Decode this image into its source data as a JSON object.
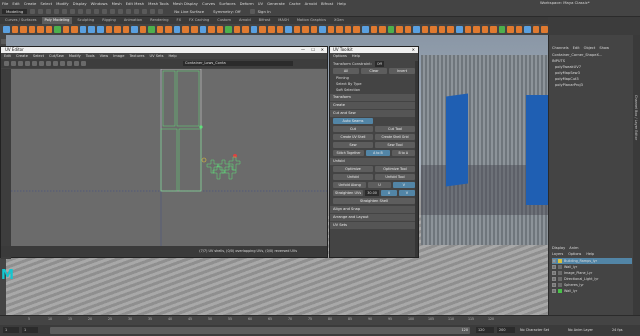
{
  "menubar": {
    "items": [
      "File",
      "Edit",
      "Create",
      "Select",
      "Modify",
      "Display",
      "Windows",
      "Mesh",
      "Edit Mesh",
      "Mesh Tools",
      "Mesh Display",
      "Curves",
      "Surfaces",
      "Deform",
      "UV",
      "Generate",
      "Cache",
      "Arnold",
      "Bifrost",
      "Help"
    ],
    "workspace_label": "Workspace:",
    "workspace_value": "Maya Classic*"
  },
  "statusline": {
    "mode": "Modeling",
    "live_surface": "No Live Surface",
    "symmetry": "Symmetry: Off",
    "signin": "Sign In"
  },
  "shelf": {
    "tabs": [
      "Curves / Surfaces",
      "Poly Modeling",
      "Sculpting",
      "Rigging",
      "Animation",
      "Rendering",
      "FX",
      "FX Caching",
      "Custom",
      "Arnold",
      "Bifrost",
      "MASH",
      "Motion Graphics",
      "XGen"
    ],
    "active_tab": "Poly Modeling",
    "icon_colors": [
      "#5aa0e0",
      "#e07a30",
      "#e07a30",
      "#e07a30",
      "#e07a30",
      "#e07a30",
      "#4db04d",
      "#e07a30",
      "#e07a30",
      "#5aa0e0",
      "#5aa0e0",
      "#5aa0e0",
      "#e07a30",
      "#e07a30",
      "#e07a30",
      "#5aa0e0",
      "#e07a30",
      "#4db04d",
      "#e07a30",
      "#e07a30",
      "#5aa0e0",
      "#e07a30",
      "#e07a30",
      "#5aa0e0",
      "#e07a30",
      "#e07a30",
      "#4db04d",
      "#e07a30",
      "#e07a30",
      "#5aa0e0",
      "#e07a30",
      "#e07a30",
      "#e07a30",
      "#5aa0e0",
      "#e07a30",
      "#e07a30",
      "#e07a30",
      "#5aa0e0",
      "#e07a30",
      "#e07a30",
      "#e07a30",
      "#e07a30",
      "#5aa0e0",
      "#e07a30",
      "#e07a30",
      "#4db04d",
      "#e07a30",
      "#e07a30",
      "#5aa0e0",
      "#e07a30",
      "#e07a30",
      "#e07a30",
      "#e07a30",
      "#5aa0e0",
      "#e07a30",
      "#e07a30",
      "#e07a30",
      "#e07a30",
      "#4db04d",
      "#e07a30",
      "#e07a30",
      "#5aa0e0",
      "#e07a30",
      "#e07a30"
    ]
  },
  "uv_editor": {
    "title": "UV Editor",
    "menu": [
      "Edit",
      "Create",
      "Select",
      "Cut/Sew",
      "Modify",
      "Tools",
      "View",
      "Image",
      "Textures",
      "UV Sets",
      "Help"
    ],
    "texture_field": "Container_Lows_Conta",
    "status": "(7/7) UV shells, (0/0) overlapping UVs, (0/0) reversed UVs"
  },
  "uv_toolkit": {
    "title": "UV Toolkit",
    "menu": [
      "Options",
      "Help"
    ],
    "transform_constraint_label": "Transform Constraint:",
    "transform_constraint_value": "Off",
    "row_buttons": [
      "All",
      "Clear",
      "Invert"
    ],
    "sections": {
      "pinning": "Pinning",
      "select_by_type": "Select By Type",
      "soft_selection": "Soft Selection",
      "transform": "Transform",
      "create": "Create",
      "cut_and_sew": "Cut and Sew",
      "unfold": "Unfold",
      "align_snap": "Align and Snap",
      "arrange_layout": "Arrange and Layout",
      "uv_sets": "UV Sets"
    },
    "cut_sew": {
      "auto_seams": "Auto Seams",
      "cut": "Cut",
      "cut_tool": "Cut Tool",
      "create_uv_shell": "Create UV Shell",
      "create_shell_grid": "Create Shell Grid",
      "sew": "Sew",
      "sew_tool": "Sew Tool",
      "stitch_together": "Stitch Together",
      "stitch_a_b": "A to B",
      "stitch_b_a": "B to A"
    },
    "unfold": {
      "optimize": "Optimize",
      "optimize_tool": "Optimize Tool",
      "unfold": "Unfold",
      "unfold_tool": "Unfold Tool",
      "unfold_along": "Unfold Along",
      "axis_u": "U",
      "axis_v": "V",
      "straighten_uvs": "Straighten UVs",
      "straighten_value": "30.00",
      "straighten_shell": "Straighten Shell"
    }
  },
  "channel_box": {
    "tabs": [
      "Channels",
      "Edit",
      "Object",
      "Show"
    ],
    "object_name": "Container_Corner_ShapeX...",
    "inputs_label": "INPUTS",
    "inputs": [
      "polyTweakUV7",
      "polyMapSew3",
      "polyMapCut3",
      "polyPlanarProj3"
    ],
    "side_tab": "Channel Box / Layer Editor"
  },
  "display": {
    "tabs": [
      "Display",
      "Anim"
    ],
    "menu": [
      "Layers",
      "Options",
      "Help"
    ],
    "layers": [
      {
        "name": "Building_Ramps_lyr",
        "vis": "V",
        "color": "#d9c23a",
        "selected": true
      },
      {
        "name": "Wall_lyr",
        "vis": "V",
        "color": "#6b6b6b",
        "selected": false
      },
      {
        "name": "Image_Plane_Lyr",
        "vis": "V",
        "color": "#6b6b6b",
        "selected": false
      },
      {
        "name": "Directional_Light_lyr",
        "vis": "V",
        "color": "#6b6b6b",
        "selected": false
      },
      {
        "name": "Spheres_lyr",
        "vis": "V",
        "color": "#6b6b6b",
        "selected": false
      },
      {
        "name": "Wall_lyr",
        "vis": "V",
        "color": "#49c249",
        "selected": false
      }
    ]
  },
  "time_slider": {
    "ticks": [
      "5",
      "10",
      "15",
      "20",
      "25",
      "30",
      "35",
      "40",
      "45",
      "50",
      "55",
      "60",
      "65",
      "70",
      "75",
      "80",
      "85",
      "90",
      "95",
      "100",
      "105",
      "110",
      "115",
      "120"
    ]
  },
  "range_slider": {
    "start": "1",
    "start_inner": "1",
    "end_inner": "120",
    "end": "120",
    "end_outer": "200",
    "character_set": "No Character Set",
    "anim_layer": "No Anim Layer",
    "fps": "24 fps"
  },
  "logo_text": "M"
}
